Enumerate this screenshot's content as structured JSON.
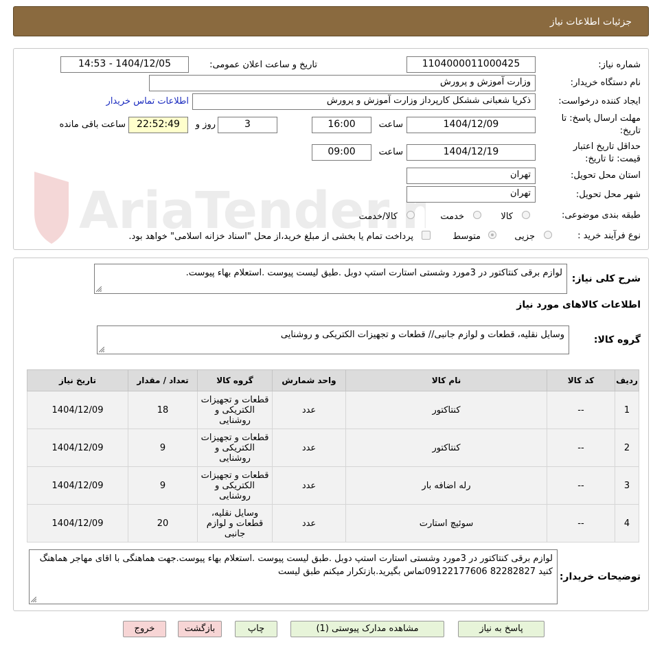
{
  "header": {
    "title": "جزئیات اطلاعات نیاز"
  },
  "fields": {
    "need_number_label": "شماره نیاز:",
    "need_number": "1104000011000425",
    "announce_label": "تاریخ و ساعت اعلان عمومی:",
    "announce_value": "1404/12/05 - 14:53",
    "buyer_org_label": "نام دستگاه خریدار:",
    "buyer_org": "وزارت آموزش و پرورش",
    "creator_label": "ایجاد کننده درخواست:",
    "creator": "ذکریا شعبانی ششکل کارپرداز وزارت آموزش و پرورش",
    "contact_link": "اطلاعات تماس خریدار",
    "deadline_label_1": "مهلت ارسال پاسخ: تا",
    "deadline_label_2": "تاریخ:",
    "deadline_date": "1404/12/09",
    "time_label": "ساعت",
    "deadline_time": "16:00",
    "days_count": "3",
    "days_label": "روز و",
    "remaining_time": "22:52:49",
    "remaining_label": "ساعت باقی مانده",
    "validity_label_1": "حداقل تاریخ اعتبار",
    "validity_label_2": "قیمت: تا تاریخ:",
    "validity_date": "1404/12/19",
    "validity_time_label": "ساعت",
    "validity_time": "09:00",
    "province_label": "استان محل تحویل:",
    "province": "تهران",
    "city_label": "شهر محل تحویل:",
    "city": "تهران",
    "category_label": "طبقه بندی موضوعی:",
    "category_options": [
      "کالا",
      "خدمت",
      "کالا/خدمت"
    ],
    "category_selected": "کالا",
    "process_label": "نوع فرآیند خرید :",
    "process_options": [
      "جزیی",
      "متوسط"
    ],
    "process_selected": "متوسط",
    "treasury_note": "پرداخت تمام یا بخشی از مبلغ خرید،از محل \"اسناد خزانه اسلامی\" خواهد بود."
  },
  "summary": {
    "label": "شرح کلی نیاز:",
    "text": "لوازم برقی کنتاکتور در 3مورد وشستی استارت استپ دوبل .طبق لیست پیوست .استعلام بهاء پیوست."
  },
  "goods_section_title": "اطلاعات کالاهای مورد نیاز",
  "goods_group": {
    "label": "گروه کالا:",
    "text": "وسایل نقلیه، قطعات و لوازم جانبی// قطعات و تجهیزات الکتریکی و روشنایی"
  },
  "table": {
    "headers": [
      "ردیف",
      "کد کالا",
      "نام کالا",
      "واحد شمارش",
      "گروه کالا",
      "تعداد / مقدار",
      "تاریخ نیاز"
    ],
    "rows": [
      [
        "1",
        "--",
        "کنتاکتور",
        "عدد",
        "قطعات و تجهیزات الکتریکی و روشنایی",
        "18",
        "1404/12/09"
      ],
      [
        "2",
        "--",
        "کنتاکتور",
        "عدد",
        "قطعات و تجهیزات الکتریکی و روشنایی",
        "9",
        "1404/12/09"
      ],
      [
        "3",
        "--",
        "رله اضافه بار",
        "عدد",
        "قطعات و تجهیزات الکتریکی و روشنایی",
        "9",
        "1404/12/09"
      ],
      [
        "4",
        "--",
        "سوئیچ استارت",
        "عدد",
        "وسایل نقلیه، قطعات و لوازم جانبی",
        "20",
        "1404/12/09"
      ]
    ]
  },
  "buyer_notes": {
    "label": "توضیحات خریدار:",
    "text": "لوازم برقی کنتاکتور در 3مورد وشستی استارت استپ دوبل .طبق لیست پیوست .استعلام بهاء پیوست.جهت هماهنگی با اقای مهاجر هماهنگ کنید 82282827 09122177606تماس بگیرید.بازتکرار میکنم طبق لیست"
  },
  "buttons": {
    "reply": "پاسخ به نیاز",
    "attachments": "مشاهده مدارک پیوستی (1)",
    "print": "چاپ",
    "back": "بازگشت",
    "exit": "خروج"
  },
  "watermark": {
    "text": "AriaTender.neT"
  },
  "colors": {
    "header_bg": "#8a6a3f",
    "button_green": "#e7f4d9",
    "button_red": "#f7d5d5",
    "highlight": "#ffffcc",
    "link": "#1a2bbf"
  }
}
